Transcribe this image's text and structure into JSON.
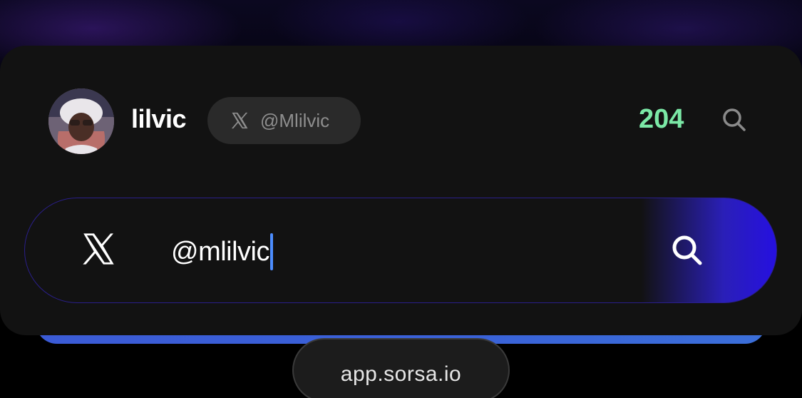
{
  "profile": {
    "username": "lilvic",
    "handle": "@Mlilvic",
    "score": "204",
    "avatar_icon": "avatar-photo",
    "platform_icon": "x-logo-icon"
  },
  "search": {
    "value": "@mlilvic",
    "platform_icon": "x-logo-icon",
    "submit_icon": "search-icon"
  },
  "header": {
    "search_icon": "search-icon"
  },
  "browser": {
    "url": "app.sorsa.io"
  },
  "colors": {
    "card_bg": "#121212",
    "score": "#7be8a6",
    "accent_blue": "#2610e0",
    "caret": "#4c8dff",
    "pill_bg": "#2a2a2a"
  }
}
